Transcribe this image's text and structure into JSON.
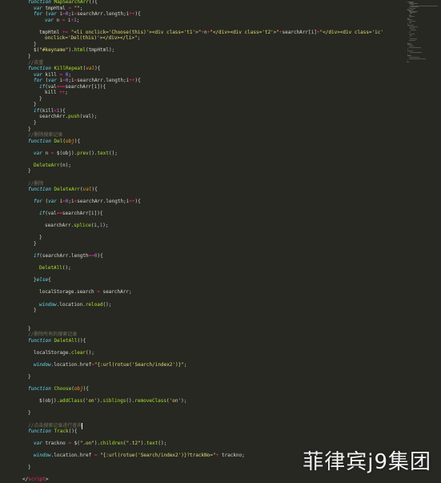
{
  "colors": {
    "background": "#272822",
    "keyword": "#66d9ef",
    "function_name": "#a6e22e",
    "string": "#e6db74",
    "comment": "#75715e",
    "number": "#ae81ff",
    "operator": "#f92672",
    "plain": "#d8d8d2"
  },
  "code_lines": [
    {
      "indent": 2,
      "tokens": [
        [
          "k",
          "function"
        ],
        [
          "p",
          " "
        ],
        [
          "f",
          "MapSearchArr"
        ],
        [
          "p",
          "(){"
        ]
      ]
    },
    {
      "indent": 3,
      "tokens": [
        [
          "k",
          "var"
        ],
        [
          "p",
          " tmpHtml "
        ],
        [
          "o",
          "="
        ],
        [
          "p",
          " "
        ],
        [
          "s",
          "\"\""
        ],
        [
          "p",
          ";"
        ]
      ]
    },
    {
      "indent": 3,
      "tokens": [
        [
          "k",
          "for"
        ],
        [
          "p",
          " ("
        ],
        [
          "k",
          "var"
        ],
        [
          "p",
          " i"
        ],
        [
          "o",
          "="
        ],
        [
          "n",
          "0"
        ],
        [
          "p",
          ";i"
        ],
        [
          "o",
          "<"
        ],
        [
          "p",
          "searchArr.length;i"
        ],
        [
          "o",
          "++"
        ],
        [
          "p",
          "){"
        ]
      ]
    },
    {
      "indent": 5,
      "tokens": [
        [
          "k",
          "var"
        ],
        [
          "p",
          " n "
        ],
        [
          "o",
          "="
        ],
        [
          "p",
          " i"
        ],
        [
          "o",
          "+"
        ],
        [
          "n",
          "1"
        ],
        [
          "p",
          ";"
        ]
      ]
    },
    {
      "indent": 0,
      "tokens": []
    },
    {
      "indent": 4,
      "tokens": [
        [
          "p",
          "tmpHtml "
        ],
        [
          "o",
          "+="
        ],
        [
          "p",
          " "
        ],
        [
          "s",
          "\"<li onclick='Choose(this)'><div class='t1'>\""
        ],
        [
          "o",
          "+"
        ],
        [
          "p",
          "n"
        ],
        [
          "o",
          "+"
        ],
        [
          "s",
          "\"</div><div class='t2'>\""
        ],
        [
          "o",
          "+"
        ],
        [
          "p",
          "searchArr[i]"
        ],
        [
          "o",
          "+"
        ],
        [
          "s",
          "\"</div><div class='ic'"
        ]
      ]
    },
    {
      "indent": 5,
      "tokens": [
        [
          "s",
          "onclick='Del(this)'></div></li>\""
        ],
        [
          "p",
          ";"
        ]
      ]
    },
    {
      "indent": 3,
      "tokens": [
        [
          "p",
          "}"
        ]
      ]
    },
    {
      "indent": 3,
      "tokens": [
        [
          "p",
          "$("
        ],
        [
          "s",
          "\"#keyname\""
        ],
        [
          "p",
          ")."
        ],
        [
          "f",
          "html"
        ],
        [
          "p",
          "(tmpHtml);"
        ]
      ]
    },
    {
      "indent": 2,
      "tokens": [
        [
          "p",
          "}"
        ]
      ]
    },
    {
      "indent": 2,
      "tokens": [
        [
          "c",
          "//去重"
        ]
      ]
    },
    {
      "indent": 2,
      "tokens": [
        [
          "k",
          "function"
        ],
        [
          "p",
          " "
        ],
        [
          "f",
          "KillRepeat"
        ],
        [
          "p",
          "("
        ],
        [
          "a",
          "val"
        ],
        [
          "p",
          "){"
        ]
      ]
    },
    {
      "indent": 3,
      "tokens": [
        [
          "k",
          "var"
        ],
        [
          "p",
          " kill "
        ],
        [
          "o",
          "="
        ],
        [
          "p",
          " "
        ],
        [
          "n",
          "0"
        ],
        [
          "p",
          ";"
        ]
      ]
    },
    {
      "indent": 3,
      "tokens": [
        [
          "k",
          "for"
        ],
        [
          "p",
          " ("
        ],
        [
          "k",
          "var"
        ],
        [
          "p",
          " i"
        ],
        [
          "o",
          "="
        ],
        [
          "n",
          "0"
        ],
        [
          "p",
          ";i"
        ],
        [
          "o",
          "<"
        ],
        [
          "p",
          "searchArr.length;i"
        ],
        [
          "o",
          "++"
        ],
        [
          "p",
          "){"
        ]
      ]
    },
    {
      "indent": 4,
      "tokens": [
        [
          "k",
          "if"
        ],
        [
          "p",
          "(val"
        ],
        [
          "o",
          "==="
        ],
        [
          "p",
          "searchArr[i]){"
        ]
      ]
    },
    {
      "indent": 5,
      "tokens": [
        [
          "p",
          "kill "
        ],
        [
          "o",
          "++"
        ],
        [
          "p",
          ";"
        ]
      ]
    },
    {
      "indent": 4,
      "tokens": [
        [
          "p",
          "}"
        ]
      ]
    },
    {
      "indent": 3,
      "tokens": [
        [
          "p",
          "}"
        ]
      ]
    },
    {
      "indent": 3,
      "tokens": [
        [
          "k",
          "if"
        ],
        [
          "p",
          "(kill"
        ],
        [
          "o",
          "<"
        ],
        [
          "n",
          "1"
        ],
        [
          "p",
          "){"
        ]
      ]
    },
    {
      "indent": 4,
      "tokens": [
        [
          "p",
          "searchArr."
        ],
        [
          "f",
          "push"
        ],
        [
          "p",
          "(val);"
        ]
      ]
    },
    {
      "indent": 3,
      "tokens": [
        [
          "p",
          "}"
        ]
      ]
    },
    {
      "indent": 2,
      "tokens": [
        [
          "p",
          "}"
        ]
      ]
    },
    {
      "indent": 2,
      "tokens": [
        [
          "c",
          "//删除搜索记录"
        ]
      ]
    },
    {
      "indent": 2,
      "tokens": [
        [
          "k",
          "function"
        ],
        [
          "p",
          " "
        ],
        [
          "f",
          "Del"
        ],
        [
          "p",
          "("
        ],
        [
          "a",
          "obj"
        ],
        [
          "p",
          "){"
        ]
      ]
    },
    {
      "indent": 0,
      "tokens": []
    },
    {
      "indent": 3,
      "tokens": [
        [
          "k",
          "var"
        ],
        [
          "p",
          " n "
        ],
        [
          "o",
          "="
        ],
        [
          "p",
          " $(obj)."
        ],
        [
          "f",
          "prev"
        ],
        [
          "p",
          "()."
        ],
        [
          "f",
          "text"
        ],
        [
          "p",
          "();"
        ]
      ]
    },
    {
      "indent": 0,
      "tokens": []
    },
    {
      "indent": 3,
      "tokens": [
        [
          "f",
          "DeleteArr"
        ],
        [
          "p",
          "(n);"
        ]
      ]
    },
    {
      "indent": 2,
      "tokens": [
        [
          "p",
          "}"
        ]
      ]
    },
    {
      "indent": 0,
      "tokens": []
    },
    {
      "indent": 2,
      "tokens": [
        [
          "c",
          "//删除"
        ]
      ]
    },
    {
      "indent": 2,
      "tokens": [
        [
          "k",
          "function"
        ],
        [
          "p",
          " "
        ],
        [
          "f",
          "DeleteArr"
        ],
        [
          "p",
          "("
        ],
        [
          "a",
          "val"
        ],
        [
          "p",
          "){"
        ]
      ]
    },
    {
      "indent": 0,
      "tokens": []
    },
    {
      "indent": 3,
      "tokens": [
        [
          "k",
          "for"
        ],
        [
          "p",
          " ("
        ],
        [
          "k",
          "var"
        ],
        [
          "p",
          " i"
        ],
        [
          "o",
          "="
        ],
        [
          "n",
          "0"
        ],
        [
          "p",
          ";i"
        ],
        [
          "o",
          "<"
        ],
        [
          "p",
          "searchArr.length;i"
        ],
        [
          "o",
          "++"
        ],
        [
          "p",
          "){"
        ]
      ]
    },
    {
      "indent": 0,
      "tokens": []
    },
    {
      "indent": 4,
      "tokens": [
        [
          "k",
          "if"
        ],
        [
          "p",
          "(val"
        ],
        [
          "o",
          "=="
        ],
        [
          "p",
          "searchArr[i]){"
        ]
      ]
    },
    {
      "indent": 0,
      "tokens": []
    },
    {
      "indent": 5,
      "tokens": [
        [
          "p",
          "searchArr."
        ],
        [
          "f",
          "splice"
        ],
        [
          "p",
          "(i,"
        ],
        [
          "n",
          "1"
        ],
        [
          "p",
          ");"
        ]
      ]
    },
    {
      "indent": 0,
      "tokens": []
    },
    {
      "indent": 4,
      "tokens": [
        [
          "p",
          "}"
        ]
      ]
    },
    {
      "indent": 3,
      "tokens": [
        [
          "p",
          "}"
        ]
      ]
    },
    {
      "indent": 0,
      "tokens": []
    },
    {
      "indent": 3,
      "tokens": [
        [
          "k",
          "if"
        ],
        [
          "p",
          "(searchArr.length"
        ],
        [
          "o",
          "=="
        ],
        [
          "n",
          "0"
        ],
        [
          "p",
          "){"
        ]
      ]
    },
    {
      "indent": 0,
      "tokens": []
    },
    {
      "indent": 4,
      "tokens": [
        [
          "f",
          "DeletAll"
        ],
        [
          "p",
          "();"
        ]
      ]
    },
    {
      "indent": 0,
      "tokens": []
    },
    {
      "indent": 3,
      "tokens": [
        [
          "p",
          "}"
        ],
        [
          "k",
          "else"
        ],
        [
          "p",
          "{"
        ]
      ]
    },
    {
      "indent": 0,
      "tokens": []
    },
    {
      "indent": 4,
      "tokens": [
        [
          "p",
          "localStorage.search "
        ],
        [
          "o",
          "="
        ],
        [
          "p",
          " searchArr;"
        ]
      ]
    },
    {
      "indent": 0,
      "tokens": []
    },
    {
      "indent": 4,
      "tokens": [
        [
          "k",
          "window"
        ],
        [
          "p",
          ".location."
        ],
        [
          "f",
          "reload"
        ],
        [
          "p",
          "();"
        ]
      ]
    },
    {
      "indent": 3,
      "tokens": [
        [
          "p",
          "}"
        ]
      ]
    },
    {
      "indent": 0,
      "tokens": []
    },
    {
      "indent": 0,
      "tokens": []
    },
    {
      "indent": 2,
      "tokens": [
        [
          "p",
          "}"
        ]
      ]
    },
    {
      "indent": 2,
      "tokens": [
        [
          "c",
          "//删除所有的搜索记录"
        ]
      ]
    },
    {
      "indent": 2,
      "tokens": [
        [
          "k",
          "function"
        ],
        [
          "p",
          " "
        ],
        [
          "f",
          "DeletAll"
        ],
        [
          "p",
          "(){"
        ]
      ]
    },
    {
      "indent": 0,
      "tokens": []
    },
    {
      "indent": 3,
      "tokens": [
        [
          "p",
          "localStorage."
        ],
        [
          "f",
          "clear"
        ],
        [
          "p",
          "();"
        ]
      ]
    },
    {
      "indent": 0,
      "tokens": []
    },
    {
      "indent": 3,
      "tokens": [
        [
          "k",
          "window"
        ],
        [
          "p",
          ".location.href"
        ],
        [
          "o",
          "="
        ],
        [
          "s",
          "\"{:url(rotue('Search/index2')}\""
        ],
        [
          "p",
          ";"
        ]
      ]
    },
    {
      "indent": 0,
      "tokens": []
    },
    {
      "indent": 2,
      "tokens": [
        [
          "p",
          "}"
        ]
      ]
    },
    {
      "indent": 0,
      "tokens": []
    },
    {
      "indent": 2,
      "tokens": [
        [
          "k",
          "function"
        ],
        [
          "p",
          " "
        ],
        [
          "f",
          "Choose"
        ],
        [
          "p",
          "("
        ],
        [
          "a",
          "obj"
        ],
        [
          "p",
          "){"
        ]
      ]
    },
    {
      "indent": 0,
      "tokens": []
    },
    {
      "indent": 4,
      "tokens": [
        [
          "p",
          "$(obj)."
        ],
        [
          "f",
          "addClass"
        ],
        [
          "p",
          "("
        ],
        [
          "s",
          "'on'"
        ],
        [
          "p",
          ")."
        ],
        [
          "f",
          "siblings"
        ],
        [
          "p",
          "()."
        ],
        [
          "f",
          "removeClass"
        ],
        [
          "p",
          "("
        ],
        [
          "s",
          "'on'"
        ],
        [
          "p",
          ");"
        ]
      ]
    },
    {
      "indent": 0,
      "tokens": []
    },
    {
      "indent": 2,
      "tokens": [
        [
          "p",
          "}"
        ]
      ]
    },
    {
      "indent": 0,
      "tokens": []
    },
    {
      "indent": 2,
      "tokens": [
        [
          "c",
          "//点击搜索记录进行查询"
        ],
        [
          "cursor",
          ""
        ]
      ]
    },
    {
      "indent": 2,
      "tokens": [
        [
          "k",
          "function"
        ],
        [
          "p",
          " "
        ],
        [
          "f",
          "Track"
        ],
        [
          "p",
          "(){"
        ]
      ]
    },
    {
      "indent": 0,
      "tokens": []
    },
    {
      "indent": 3,
      "tokens": [
        [
          "k",
          "var"
        ],
        [
          "p",
          " trackno "
        ],
        [
          "o",
          "="
        ],
        [
          "p",
          " $("
        ],
        [
          "s",
          "\".on\""
        ],
        [
          "p",
          ")."
        ],
        [
          "f",
          "children"
        ],
        [
          "p",
          "("
        ],
        [
          "s",
          "\".t2\""
        ],
        [
          "p",
          ")."
        ],
        [
          "f",
          "text"
        ],
        [
          "p",
          "();"
        ]
      ]
    },
    {
      "indent": 0,
      "tokens": []
    },
    {
      "indent": 3,
      "tokens": [
        [
          "k",
          "window"
        ],
        [
          "p",
          ".location.href "
        ],
        [
          "o",
          "="
        ],
        [
          "p",
          " "
        ],
        [
          "s",
          "\"{:url(rotue('Search/index2')}?trackNo=\""
        ],
        [
          "o",
          "+"
        ],
        [
          "p",
          " trackno;"
        ]
      ]
    },
    {
      "indent": 0,
      "tokens": []
    },
    {
      "indent": 2,
      "tokens": [
        [
          "p",
          "}"
        ]
      ]
    },
    {
      "indent": 0,
      "tokens": []
    },
    {
      "indent": 1,
      "tokens": [
        [
          "p",
          "</"
        ],
        [
          "o",
          "script"
        ],
        [
          "p",
          ">"
        ]
      ]
    }
  ],
  "watermark": {
    "text": "菲律宾j9集团"
  }
}
